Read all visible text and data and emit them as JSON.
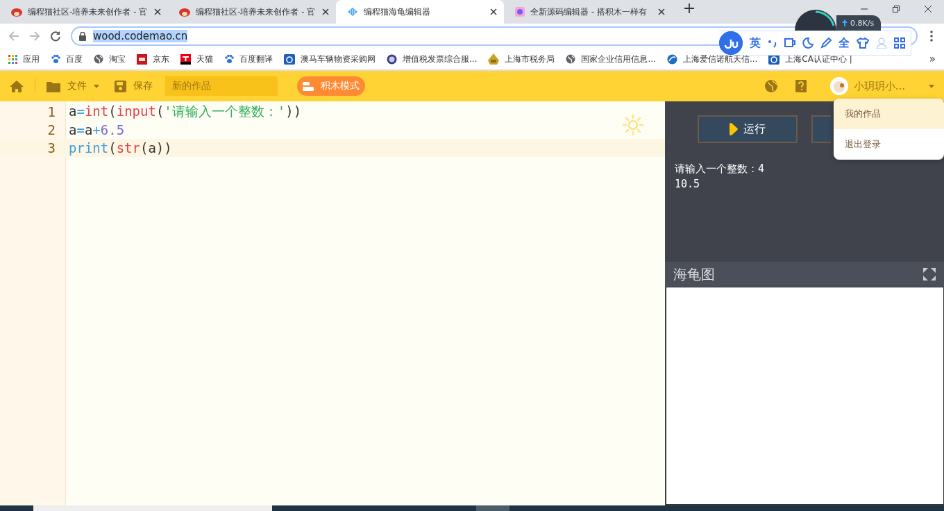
{
  "browser": {
    "tabs": [
      {
        "title": "编程猫社区-培养未来创作者 - 官",
        "kind": "cat",
        "selected": false
      },
      {
        "title": "编程猫社区-培养未来创作者 - 官",
        "kind": "cat",
        "selected": false
      },
      {
        "title": "编程猫海龟编辑器",
        "kind": "fish",
        "selected": true
      },
      {
        "title": "全新源码编辑器 - 搭积木一样有",
        "kind": "app",
        "selected": false
      }
    ],
    "address": "wood.codemao.cn",
    "bookmarks": [
      {
        "label": "应用",
        "kind": "grid"
      },
      {
        "label": "百度",
        "kind": "paw"
      },
      {
        "label": "淘宝",
        "kind": "globe"
      },
      {
        "label": "京东",
        "kind": "red"
      },
      {
        "label": "天猫",
        "kind": "black"
      },
      {
        "label": "百度翻译",
        "kind": "paw"
      },
      {
        "label": "澳马车辆物资采购网",
        "kind": "blue"
      },
      {
        "label": "增值税发票综合服...",
        "kind": "disc"
      },
      {
        "label": "上海市税务局",
        "kind": "emblem"
      },
      {
        "label": "国家企业信用信息...",
        "kind": "globe"
      },
      {
        "label": "上海爱信诺航天信...",
        "kind": "swirl"
      },
      {
        "label": "上海CA认证中心 |",
        "kind": "blue"
      }
    ],
    "more_bookmarks": "»"
  },
  "overlays": {
    "net_speed": "0.8K/s",
    "ime_labels": [
      "英",
      "全"
    ]
  },
  "toolbar": {
    "file_menu": "文件",
    "save": "保存",
    "project_name": "新的作品",
    "mode_button": "积木模式",
    "user_name": "小玥玥小..."
  },
  "user_menu": {
    "items": [
      {
        "label": "我的作品",
        "selected": true
      },
      {
        "label": "退出登录",
        "selected": false
      }
    ]
  },
  "editor": {
    "lines": [
      {
        "number": "1",
        "active": false,
        "tokens": [
          {
            "kind": "plain",
            "text": "a"
          },
          {
            "kind": "op",
            "text": "="
          },
          {
            "kind": "builtin",
            "text": "int"
          },
          {
            "kind": "plain",
            "text": "("
          },
          {
            "kind": "builtin",
            "text": "input"
          },
          {
            "kind": "plain",
            "text": "("
          },
          {
            "kind": "string",
            "text": "'请输入一个整数：'"
          },
          {
            "kind": "plain",
            "text": "))"
          }
        ]
      },
      {
        "number": "2",
        "active": false,
        "tokens": [
          {
            "kind": "plain",
            "text": "a"
          },
          {
            "kind": "op",
            "text": "="
          },
          {
            "kind": "plain",
            "text": "a"
          },
          {
            "kind": "op",
            "text": "+"
          },
          {
            "kind": "number",
            "text": "6.5"
          }
        ]
      },
      {
        "number": "3",
        "active": true,
        "tokens": [
          {
            "kind": "op",
            "text": "print"
          },
          {
            "kind": "plain",
            "text": "("
          },
          {
            "kind": "builtin",
            "text": "str"
          },
          {
            "kind": "plain",
            "text": "(a))"
          }
        ]
      }
    ]
  },
  "run_panel": {
    "run_button": "运行",
    "console": [
      "请输入一个整数：4",
      "10.5"
    ]
  },
  "turtle_panel": {
    "title": "海龟图"
  }
}
